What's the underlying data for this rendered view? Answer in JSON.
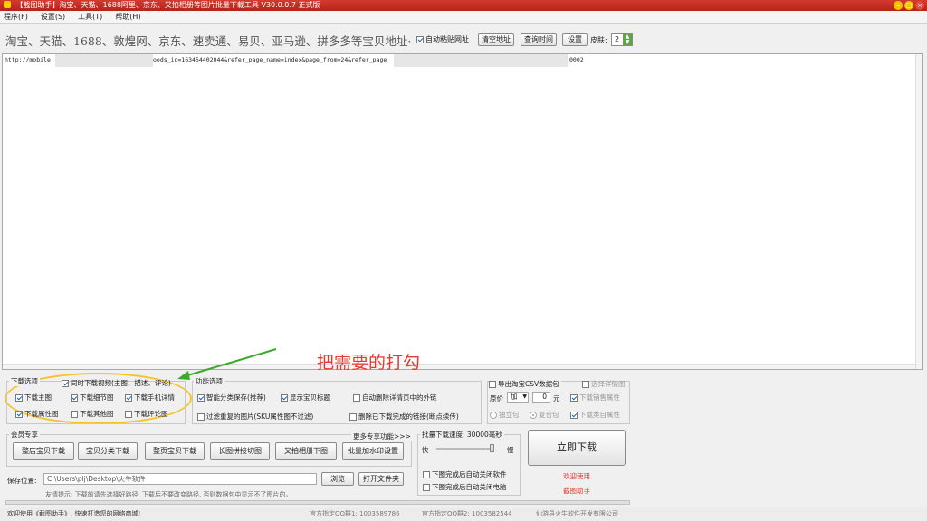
{
  "window": {
    "title": "【截图助手】淘宝、天猫、1688阿里、京东、又拍相册等图片批量下载工具 V30.0.0.7 正式版"
  },
  "menu": [
    "程序(F)",
    "设置(S)",
    "工具(T)",
    "帮助(H)"
  ],
  "toolbar": {
    "sites_text": "淘宝、天猫、1688、敦煌网、京东、速卖通、易贝、亚马逊、拼多多等宝贝地址·",
    "auto_paste_label": "自动粘贴网址",
    "clear_label": "清空地址",
    "query_label": "查询时间",
    "settings_label": "设置",
    "skin_label": "皮肤:",
    "skin_value": "2"
  },
  "url_box": {
    "line_start": "http://mobile",
    "line_mid": "oods_id=163454402044&refer_page_name=index&page_from=24&refer_page",
    "line_end": "0002"
  },
  "annotation": {
    "text": "把需要的打勾",
    "color": "#e8372c",
    "arrow_color": "#3aaa2a",
    "circle_color": "#f5c42c"
  },
  "download_options": {
    "title": "下载选项",
    "video_label": "同时下载视频(主图、描述、评论)",
    "main_images": "下载主图",
    "detail_images": "下载细节图",
    "mobile_detail": "下载手机详情",
    "attr_images": "下载属性图",
    "other_images": "下载其他图",
    "review_images": "下载评论图"
  },
  "function_options": {
    "title": "功能选项",
    "smart_save": "智能分类保存(推荐)",
    "show_title": "显示宝贝标题",
    "auto_delete": "自动删除详情页中的外链",
    "filter_dup": "过滤重复的图片(SKU属性图不过滤)",
    "delete_done": "删除已下载完成的链接(断点续传)"
  },
  "csv_options": {
    "export_csv": "导出淘宝CSV数据包",
    "detail_info": "选择详情图",
    "price_label": "原价",
    "price_op": "加",
    "price_value": "0",
    "price_unit": "元",
    "sales_attr": "下载销售属性",
    "standalone": "独立包",
    "merged": "复合包",
    "category_attr": "下载类目属性"
  },
  "member": {
    "title": "会员专享",
    "more_link": "更多专享功能>>>",
    "buttons": [
      "整店宝贝下载",
      "宝贝分类下载",
      "整页宝贝下载",
      "长图拼接切图",
      "又拍相册下图",
      "批量加水印设置"
    ]
  },
  "batch": {
    "title": "批量下载速度: 30000毫秒",
    "fast": "快",
    "slow": "慢",
    "speed_ms": 30000,
    "close_software": "下图完成后自动关闭软件",
    "shutdown": "下图完成后自动关闭电脑"
  },
  "download_now": "立即下载",
  "promo": {
    "line1": "欢迎使用",
    "line2": "截图助手"
  },
  "save": {
    "label": "保存位置:",
    "path": "C:\\Users\\plj\\Desktop\\火牛软件",
    "browse": "浏览",
    "open_folder": "打开文件夹",
    "tip": "友情提示: 下载前请先选择好路径, 下载后不要改变路径, 否则数据包中显示不了图片的。"
  },
  "status": {
    "welcome": "欢迎使用《截图助手》, 快速打造您的网络商城!",
    "qq1": "官方指定QQ群1: 1003589786",
    "qq2": "官方指定QQ群2: 1003582544",
    "company": "仙游县火牛软件开发有限公司"
  }
}
